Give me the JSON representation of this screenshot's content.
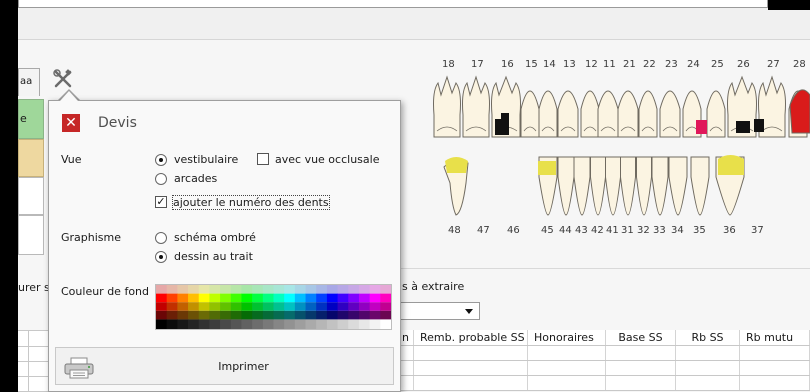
{
  "tabs": {
    "stub_label": "aa"
  },
  "side": {
    "row1_label": "e"
  },
  "labels": {
    "surer": "urer s",
    "extraire": "s à extraire"
  },
  "table": {
    "headers": [
      "n",
      "Remb. probable SS",
      "Honoraires",
      "Base SS",
      "Rb SS",
      "Rb mutu"
    ]
  },
  "popup": {
    "title": "Devis",
    "close_glyph": "✕",
    "vue_label": "Vue",
    "vestibulaire": "vestibulaire",
    "avec_vue_occlusale": "avec vue occlusale",
    "arcades": "arcades",
    "ajouter_numero": "ajouter le numéro des dents",
    "check_glyph": "✓",
    "graphisme_label": "Graphisme",
    "schema_ombre": "schéma ombré",
    "dessin_au_trait": "dessin au trait",
    "couleur_label": "Couleur de fond",
    "imprimer": "Imprimer",
    "state": {
      "vue": "vestibulaire",
      "avec_vue_occlusale": false,
      "ajouter_numero": true,
      "graphisme": "dessin au trait"
    }
  },
  "teeth": {
    "upper_numbers": [
      "18",
      "17",
      "16",
      "15",
      "14",
      "13",
      "12",
      "11",
      "21",
      "22",
      "23",
      "24",
      "25",
      "26",
      "27",
      "28"
    ],
    "lower_numbers": [
      "48",
      "47",
      "46",
      "45",
      "44",
      "43",
      "42",
      "41",
      "31",
      "32",
      "33",
      "34",
      "35",
      "36",
      "37"
    ],
    "colors": {
      "tooth_fill": "#fbf4e2",
      "outline": "#6f6a60",
      "black_fill": "#111111",
      "pink_fill": "#e0185a",
      "yellow_fill": "#e8e04a",
      "red_fill": "#d91b1b"
    }
  },
  "icons": {
    "tools": "tools-icon",
    "printer": "printer-icon",
    "close": "close-icon"
  }
}
